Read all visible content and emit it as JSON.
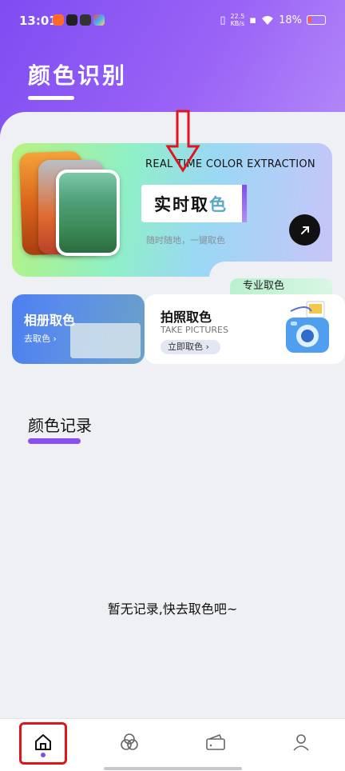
{
  "status_bar": {
    "time": "13:01",
    "net_speed_value": "22.5",
    "net_speed_unit": "KB/s",
    "battery": "18%"
  },
  "header": {
    "title": "颜色识别"
  },
  "hero": {
    "english_title": "REAL TIME COLOR EXTRACTION",
    "tag_label_a": "实时取",
    "tag_label_b": "色",
    "subtitle": "随时随地，一键取色",
    "go_icon": "arrow-up-right-icon"
  },
  "pro_section": {
    "label": "专业取色"
  },
  "album_card": {
    "title": "相册取色",
    "button": "去取色 ›"
  },
  "photo_card": {
    "title": "拍照取色",
    "english": "TAKE PICTURES",
    "button": "立即取色 ›"
  },
  "records": {
    "title": "颜色记录",
    "empty_text": "暂无记录,快去取色吧~"
  },
  "tab_bar": {
    "items": [
      {
        "icon": "home-icon",
        "active": true
      },
      {
        "icon": "color-circles-icon",
        "active": false
      },
      {
        "icon": "wallet-icon",
        "active": false
      },
      {
        "icon": "profile-icon",
        "active": false
      }
    ]
  },
  "colors": {
    "accent": "#7e4cf2",
    "highlight_annotation": "#e0141c"
  }
}
